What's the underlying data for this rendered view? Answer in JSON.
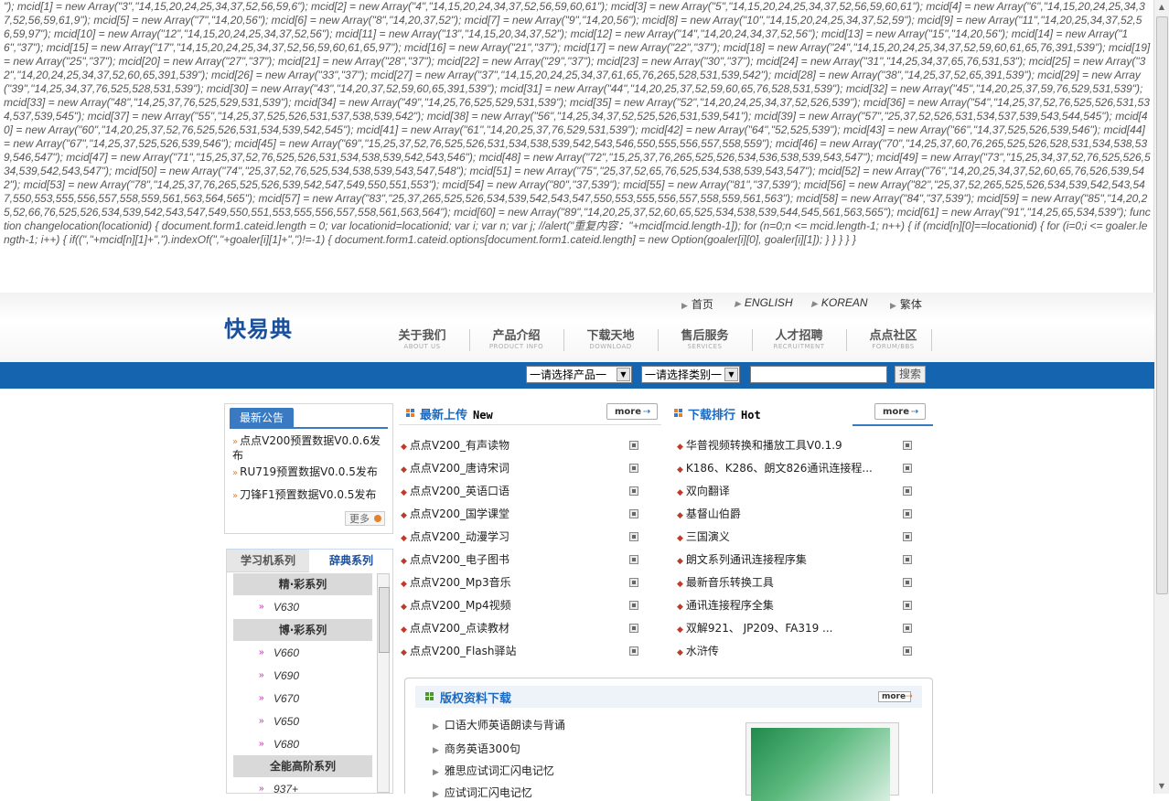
{
  "leaked_script": "\"); mcid[1] = new Array(\"3\",\"14,15,20,24,25,34,37,52,56,59,6\"); mcid[2] = new Array(\"4\",\"14,15,20,24,34,37,52,56,59,60,61\"); mcid[3] = new Array(\"5\",\"14,15,20,24,25,34,37,52,56,59,60,61\"); mcid[4] = new Array(\"6\",\"14,15,20,24,25,34,37,52,56,59,61,9\"); mcid[5] = new Array(\"7\",\"14,20,56\"); mcid[6] = new Array(\"8\",\"14,20,37,52\"); mcid[7] = new Array(\"9\",\"14,20,56\"); mcid[8] = new Array(\"10\",\"14,15,20,24,25,34,37,52,59\"); mcid[9] = new Array(\"11\",\"14,20,25,34,37,52,56,59,97\"); mcid[10] = new Array(\"12\",\"14,15,20,24,25,34,37,52,56\"); mcid[11] = new Array(\"13\",\"14,15,20,34,37,52\"); mcid[12] = new Array(\"14\",\"14,20,24,34,37,52,56\"); mcid[13] = new Array(\"15\",\"14,20,56\"); mcid[14] = new Array(\"16\",\"37\"); mcid[15] = new Array(\"17\",\"14,15,20,24,25,34,37,52,56,59,60,61,65,97\"); mcid[16] = new Array(\"21\",\"37\"); mcid[17] = new Array(\"22\",\"37\"); mcid[18] = new Array(\"24\",\"14,15,20,24,25,34,37,52,59,60,61,65,76,391,539\"); mcid[19] = new Array(\"25\",\"37\"); mcid[20] = new Array(\"27\",\"37\"); mcid[21] = new Array(\"28\",\"37\"); mcid[22] = new Array(\"29\",\"37\"); mcid[23] = new Array(\"30\",\"37\"); mcid[24] = new Array(\"31\",\"14,25,34,37,65,76,531,53\"); mcid[25] = new Array(\"32\",\"14,20,24,25,34,37,52,60,65,391,539\"); mcid[26] = new Array(\"33\",\"37\"); mcid[27] = new Array(\"37\",\"14,15,20,24,25,34,37,61,65,76,265,528,531,539,542\"); mcid[28] = new Array(\"38\",\"14,25,37,52,65,391,539\"); mcid[29] = new Array(\"39\",\"14,25,34,37,76,525,528,531,539\"); mcid[30] = new Array(\"43\",\"14,20,37,52,59,60,65,391,539\"); mcid[31] = new Array(\"44\",\"14,20,25,37,52,59,60,65,76,528,531,539\"); mcid[32] = new Array(\"45\",\"14,20,25,37,59,76,529,531,539\"); mcid[33] = new Array(\"48\",\"14,25,37,76,525,529,531,539\"); mcid[34] = new Array(\"49\",\"14,25,76,525,529,531,539\"); mcid[35] = new Array(\"52\",\"14,20,24,25,34,37,52,526,539\"); mcid[36] = new Array(\"54\",\"14,25,37,52,76,525,526,531,534,537,539,545\"); mcid[37] = new Array(\"55\",\"14,25,37,525,526,531,537,538,539,542\"); mcid[38] = new Array(\"56\",\"14,25,34,37,52,525,526,531,539,541\"); mcid[39] = new Array(\"57\",\"25,37,52,526,531,534,537,539,543,544,545\"); mcid[40] = new Array(\"60\",\"14,20,25,37,52,76,525,526,531,534,539,542,545\"); mcid[41] = new Array(\"61\",\"14,20,25,37,76,529,531,539\"); mcid[42] = new Array(\"64\",\"52,525,539\"); mcid[43] = new Array(\"66\",\"14,37,525,526,539,546\"); mcid[44] = new Array(\"67\",\"14,25,37,525,526,539,546\"); mcid[45] = new Array(\"69\",\"15,25,37,52,76,525,526,531,534,538,539,542,543,546,550,555,556,557,558,559\"); mcid[46] = new Array(\"70\",\"14,25,37,60,76,265,525,526,528,531,534,538,539,546,547\"); mcid[47] = new Array(\"71\",\"15,25,37,52,76,525,526,531,534,538,539,542,543,546\"); mcid[48] = new Array(\"72\",\"15,25,37,76,265,525,526,534,536,538,539,543,547\"); mcid[49] = new Array(\"73\",\"15,25,34,37,52,76,525,526,534,539,542,543,547\"); mcid[50] = new Array(\"74\",\"25,37,52,76,525,534,538,539,543,547,548\"); mcid[51] = new Array(\"75\",\"25,37,52,65,76,525,534,538,539,543,547\"); mcid[52] = new Array(\"76\",\"14,20,25,34,37,52,60,65,76,526,539,542\"); mcid[53] = new Array(\"78\",\"14,25,37,76,265,525,526,539,542,547,549,550,551,553\"); mcid[54] = new Array(\"80\",\"37,539\"); mcid[55] = new Array(\"81\",\"37,539\"); mcid[56] = new Array(\"82\",\"25,37,52,265,525,526,534,539,542,543,547,550,553,555,556,557,558,559,561,563,564,565\"); mcid[57] = new Array(\"83\",\"25,37,265,525,526,534,539,542,543,547,550,553,555,556,557,558,559,561,563\"); mcid[58] = new Array(\"84\",\"37,539\"); mcid[59] = new Array(\"85\",\"14,20,25,52,66,76,525,526,534,539,542,543,547,549,550,551,553,555,556,557,558,561,563,564\"); mcid[60] = new Array(\"89\",\"14,20,25,37,52,60,65,525,534,538,539,544,545,561,563,565\"); mcid[61] = new Array(\"91\",\"14,25,65,534,539\"); function changelocation(locationid) { document.form1.cateid.length = 0; var locationid=locationid; var i; var n; var j; //alert(\"重复内容：\"+mcid[mcid.length-1]); for (n=0;n <= mcid.length-1; n++) { if (mcid[n][0]==locationid) { for (i=0;i <= goaler.length-1; i++) { if((\",\"+mcid[n][1]+\",\").indexOf(\",\"+goaler[i][1]+\",\")!=-1) { document.form1.cateid.options[document.form1.cateid.length] = new Option(goaler[i][0], goaler[i][1]); } } } } }",
  "colors": {
    "brand_blue": "#1464b0",
    "title_blue": "#1a6ac2",
    "accent_orange": "#e6802a"
  },
  "toplinks": [
    "首页",
    "ENGLISH",
    "KOREAN",
    "繁体"
  ],
  "logo": "快易典",
  "nav": [
    {
      "cn": "关于我们",
      "en": "ABOUT US"
    },
    {
      "cn": "产品介绍",
      "en": "PRODUCT INFO"
    },
    {
      "cn": "下载天地",
      "en": "DOWNLOAD"
    },
    {
      "cn": "售后服务",
      "en": "SERVICES"
    },
    {
      "cn": "人才招聘",
      "en": "RECRUITMENT"
    },
    {
      "cn": "点点社区",
      "en": "FORUM/BBS"
    }
  ],
  "search": {
    "product_select": "一请选择产品一",
    "category_select": "一请选择类别一",
    "query": "",
    "button": "搜索"
  },
  "notice": {
    "title": "最新公告",
    "items": [
      "点点V200预置数据V0.0.6发布",
      "RU719预置数据V0.0.5发布",
      "刀锋F1预置数据V0.0.5发布"
    ],
    "more": "更多"
  },
  "series": {
    "tabs": [
      "学习机系列",
      "辞典系列"
    ],
    "rows": [
      {
        "type": "cat",
        "text": "精·彩系列"
      },
      {
        "type": "model",
        "text": "V630"
      },
      {
        "type": "cat",
        "text": "博·彩系列"
      },
      {
        "type": "model",
        "text": "V660"
      },
      {
        "type": "model",
        "text": "V690"
      },
      {
        "type": "model",
        "text": "V670"
      },
      {
        "type": "model",
        "text": "V650"
      },
      {
        "type": "model",
        "text": "V680"
      },
      {
        "type": "cat",
        "text": "全能高阶系列"
      },
      {
        "type": "model",
        "text": "937+"
      }
    ]
  },
  "latest": {
    "title": "最新上传",
    "subtitle": "New",
    "more": "more",
    "items": [
      "点点V200_有声读物",
      "点点V200_唐诗宋词",
      "点点V200_英语口语",
      "点点V200_国学课堂",
      "点点V200_动漫学习",
      "点点V200_电子图书",
      "点点V200_Mp3音乐",
      "点点V200_Mp4视频",
      "点点V200_点读教材",
      "点点V200_Flash驿站"
    ]
  },
  "ranking": {
    "title": "下载排行",
    "subtitle": "Hot",
    "more": "more",
    "items": [
      "华普视频转换和播放工具V0.1.9",
      "K186、K286、朗文826通讯连接程...",
      "双向翻译",
      "基督山伯爵",
      "三国演义",
      "朗文系列通讯连接程序集",
      "最新音乐转换工具",
      "通讯连接程序全集",
      "双解921、 JP209、FA319 ...",
      "水浒传"
    ]
  },
  "copyright": {
    "title": "版权资料下载",
    "more": "more",
    "items": [
      "口语大师英语朗读与背诵",
      "商务英语300句",
      "雅思应试词汇闪电记忆",
      "应试词汇闪电记忆"
    ]
  }
}
